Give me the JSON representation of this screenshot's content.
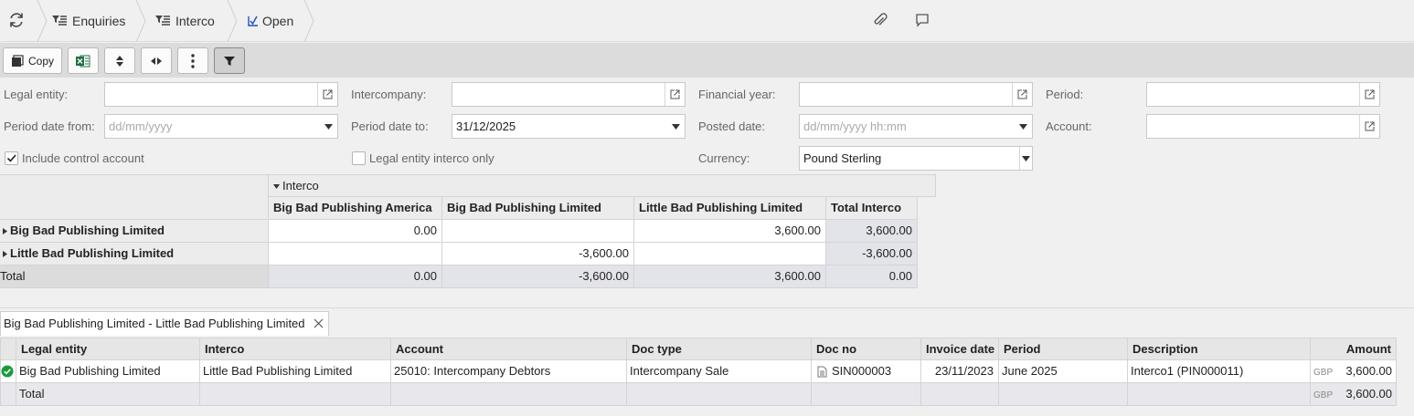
{
  "breadcrumb": {
    "items": [
      {
        "label": "Enquiries"
      },
      {
        "label": "Interco"
      },
      {
        "label": "Open"
      }
    ]
  },
  "toolbar": {
    "copy_label": "Copy"
  },
  "filters": {
    "legal_entity": {
      "label": "Legal entity:",
      "value": ""
    },
    "intercompany": {
      "label": "Intercompany:",
      "value": ""
    },
    "financial_year": {
      "label": "Financial year:",
      "value": ""
    },
    "period": {
      "label": "Period:",
      "value": ""
    },
    "period_date_from": {
      "label": "Period date from:",
      "placeholder": "dd/mm/yyyy"
    },
    "period_date_to": {
      "label": "Period date to:",
      "value": "31/12/2025"
    },
    "posted_date": {
      "label": "Posted date:",
      "placeholder": "dd/mm/yyyy hh:mm"
    },
    "account": {
      "label": "Account:",
      "value": ""
    },
    "include_control_account": {
      "label": "Include control account",
      "checked": true
    },
    "legal_entity_interco_only": {
      "label": "Legal entity interco only",
      "checked": false
    },
    "currency": {
      "label": "Currency:",
      "value": "Pound Sterling"
    }
  },
  "pivot": {
    "group_label": "Interco",
    "columns": [
      "Big Bad Publishing America",
      "Big Bad Publishing Limited",
      "Little Bad Publishing Limited",
      "Total Interco"
    ],
    "rows": [
      {
        "label": "Big Bad Publishing Limited",
        "values": [
          "0.00",
          "",
          "3,600.00",
          "3,600.00"
        ]
      },
      {
        "label": "Little Bad Publishing Limited",
        "values": [
          "",
          "-3,600.00",
          "",
          "-3,600.00"
        ]
      }
    ],
    "total": {
      "label": "Total",
      "values": [
        "0.00",
        "-3,600.00",
        "3,600.00",
        "0.00"
      ]
    }
  },
  "detail_tab": {
    "label": "Big Bad Publishing Limited - Little Bad Publishing Limited"
  },
  "grid": {
    "columns": [
      "Legal entity",
      "Interco",
      "Account",
      "Doc type",
      "Doc no",
      "Invoice date",
      "Period",
      "Description",
      "Amount"
    ],
    "rows": [
      {
        "legal_entity": "Big Bad Publishing Limited",
        "interco": "Little Bad Publishing Limited",
        "account": "25010: Intercompany Debtors",
        "doc_type": "Intercompany Sale",
        "doc_no": "SIN000003",
        "invoice_date": "23/11/2023",
        "period": "June 2025",
        "description": "Interco1 (PIN000011)",
        "currency": "GBP",
        "amount": "3,600.00"
      }
    ],
    "total": {
      "label": "Total",
      "currency": "GBP",
      "amount": "3,600.00"
    }
  },
  "colors": {
    "accent_check": "#1a9b3c",
    "link_blue": "#1f4fbf"
  }
}
